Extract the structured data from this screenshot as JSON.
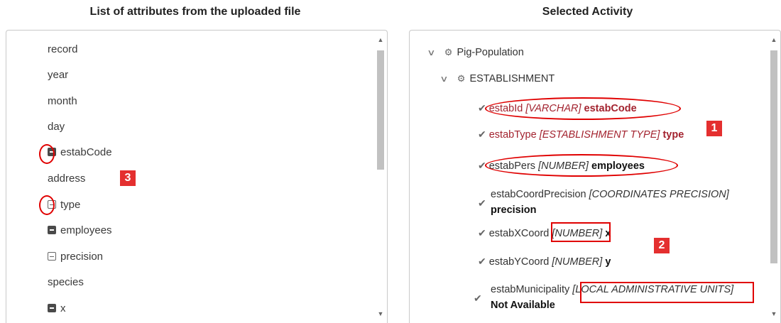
{
  "left": {
    "title": "List of attributes from the uploaded file",
    "items": [
      {
        "label": "record",
        "icon": "none"
      },
      {
        "label": "year",
        "icon": "none"
      },
      {
        "label": "month",
        "icon": "none"
      },
      {
        "label": "day",
        "icon": "none"
      },
      {
        "label": "estabCode",
        "icon": "filled-minus-icon"
      },
      {
        "label": "address",
        "icon": "none"
      },
      {
        "label": "type",
        "icon": "outline-minus-icon"
      },
      {
        "label": "employees",
        "icon": "filled-minus-icon"
      },
      {
        "label": "precision",
        "icon": "outline-minus-icon"
      },
      {
        "label": "species",
        "icon": "none"
      },
      {
        "label": "x",
        "icon": "filled-minus-icon"
      }
    ],
    "badge": "3"
  },
  "right": {
    "title": "Selected Activity",
    "activity": "Pig-Population",
    "entity": "ESTABLISHMENT",
    "fields": [
      {
        "name": "estabId",
        "type": "[VARCHAR]",
        "value": "estabCode"
      },
      {
        "name": "estabType",
        "type": "[ESTABLISHMENT TYPE]",
        "value": "type"
      },
      {
        "name": "estabPers",
        "type": "[NUMBER]",
        "value": "employees"
      },
      {
        "name": "estabCoordPrecision",
        "type": "[COORDINATES PRECISION]",
        "value": "precision"
      },
      {
        "name": "estabXCoord",
        "type": "[NUMBER]",
        "value": "x"
      },
      {
        "name": "estabYCoord",
        "type": "[NUMBER]",
        "value": "y"
      },
      {
        "name": "estabMunicipality",
        "type": "[LOCAL ADMINISTRATIVE UNITS]",
        "value": "Not Available"
      }
    ],
    "badges": [
      "1",
      "2"
    ]
  },
  "colors": {
    "field_red": "#a3232f",
    "annotation_red": "#e00000",
    "badge_red": "#e42f2f"
  }
}
